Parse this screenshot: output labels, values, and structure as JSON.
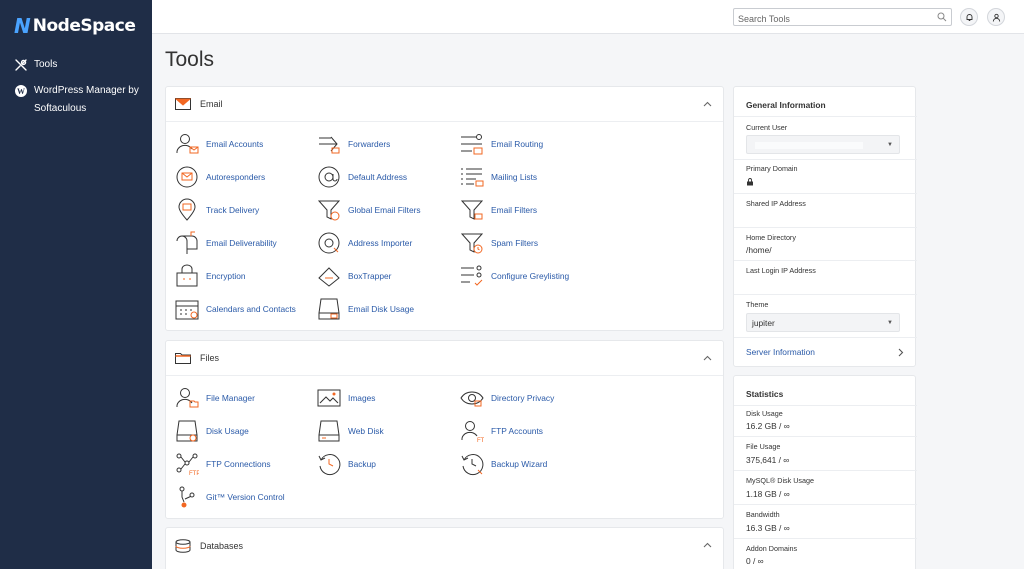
{
  "brand": {
    "name": "NodeSpace",
    "mark": "N"
  },
  "sidebar": {
    "items": [
      {
        "label": "Tools",
        "icon": "tools-icon"
      },
      {
        "label": "WordPress Manager by Softaculous",
        "icon": "wordpress-icon"
      }
    ]
  },
  "search": {
    "placeholder": "Search Tools"
  },
  "header": {
    "title": "Tools"
  },
  "accent_color": "#f26722",
  "link_color": "#2a5aa8",
  "sections": {
    "email": {
      "title": "Email",
      "tools": [
        "Email Accounts",
        "Forwarders",
        "Email Routing",
        "Autoresponders",
        "Default Address",
        "Mailing Lists",
        "Track Delivery",
        "Global Email Filters",
        "Email Filters",
        "Email Deliverability",
        "Address Importer",
        "Spam Filters",
        "Encryption",
        "BoxTrapper",
        "Configure Greylisting",
        "Calendars and Contacts",
        "Email Disk Usage"
      ]
    },
    "files": {
      "title": "Files",
      "tools": [
        "File Manager",
        "Images",
        "Directory Privacy",
        "Disk Usage",
        "Web Disk",
        "FTP Accounts",
        "FTP Connections",
        "Backup",
        "Backup Wizard",
        "Git™ Version Control"
      ]
    },
    "databases": {
      "title": "Databases"
    }
  },
  "general_info": {
    "title": "General Information",
    "current_user_label": "Current User",
    "current_user_value": "",
    "primary_domain_label": "Primary Domain",
    "shared_ip_label": "Shared IP Address",
    "home_dir_label": "Home Directory",
    "home_dir_value": "/home/",
    "last_login_label": "Last Login IP Address",
    "theme_label": "Theme",
    "theme_value": "jupiter",
    "server_info_link": "Server Information"
  },
  "statistics": {
    "title": "Statistics",
    "rows": [
      {
        "label": "Disk Usage",
        "value": "16.2 GB / ∞"
      },
      {
        "label": "File Usage",
        "value": "375,641 / ∞"
      },
      {
        "label": "MySQL® Disk Usage",
        "value": "1.18 GB / ∞"
      },
      {
        "label": "Bandwidth",
        "value": "16.3 GB / ∞"
      },
      {
        "label": "Addon Domains",
        "value": "0 / ∞"
      }
    ]
  }
}
